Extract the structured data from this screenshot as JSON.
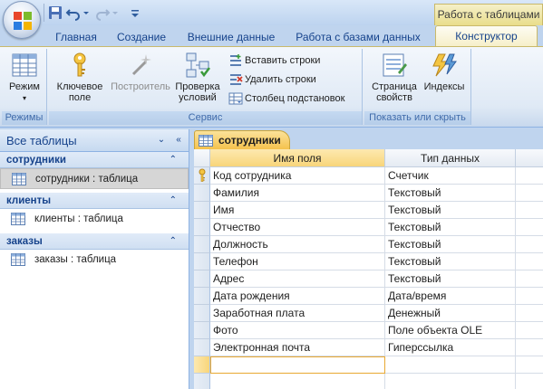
{
  "context_title": "Работа с таблицами",
  "tabs": [
    "Главная",
    "Создание",
    "Внешние данные",
    "Работа с базами данных",
    "Конструктор"
  ],
  "active_tab": "Конструктор",
  "ribbon": {
    "groups": {
      "modes": "Режимы",
      "service": "Сервис",
      "show_hide": "Показать или скрыть"
    },
    "buttons": {
      "view": "Режим",
      "primary_key_1": "Ключевое",
      "primary_key_2": "поле",
      "builder": "Построитель",
      "test_rules_1": "Проверка",
      "test_rules_2": "условий",
      "insert_rows": "Вставить строки",
      "delete_rows": "Удалить строки",
      "lookup_column": "Столбец  подстановок",
      "property_sheet_1": "Страница",
      "property_sheet_2": "свойств",
      "indexes": "Индексы"
    }
  },
  "nav": {
    "header": "Все таблицы",
    "groups": [
      {
        "title": "сотрудники",
        "item": "сотрудники : таблица"
      },
      {
        "title": "клиенты",
        "item": "клиенты : таблица"
      },
      {
        "title": "заказы",
        "item": "заказы : таблица"
      }
    ]
  },
  "doc": {
    "tab_label": "сотрудники",
    "columns": [
      "Имя поля",
      "Тип данных"
    ],
    "rows": [
      {
        "name": "Код сотрудника",
        "type": "Счетчик"
      },
      {
        "name": "Фамилия",
        "type": "Текстовый"
      },
      {
        "name": "Имя",
        "type": "Текстовый"
      },
      {
        "name": "Отчество",
        "type": "Текстовый"
      },
      {
        "name": "Должность",
        "type": "Текстовый"
      },
      {
        "name": "Телефон",
        "type": "Текстовый"
      },
      {
        "name": "Адрес",
        "type": "Текстовый"
      },
      {
        "name": "Дата рождения",
        "type": "Дата/время"
      },
      {
        "name": "Заработная плата",
        "type": "Денежный"
      },
      {
        "name": "Фото",
        "type": "Поле объекта OLE"
      },
      {
        "name": "Электронная почта",
        "type": "Гиперссылка"
      },
      {
        "name": "",
        "type": ""
      },
      {
        "name": "",
        "type": ""
      }
    ]
  },
  "colors": {
    "ribbon_text": "#15428b",
    "context_tab": "#f5c24d",
    "selection": "#f8d57a"
  }
}
